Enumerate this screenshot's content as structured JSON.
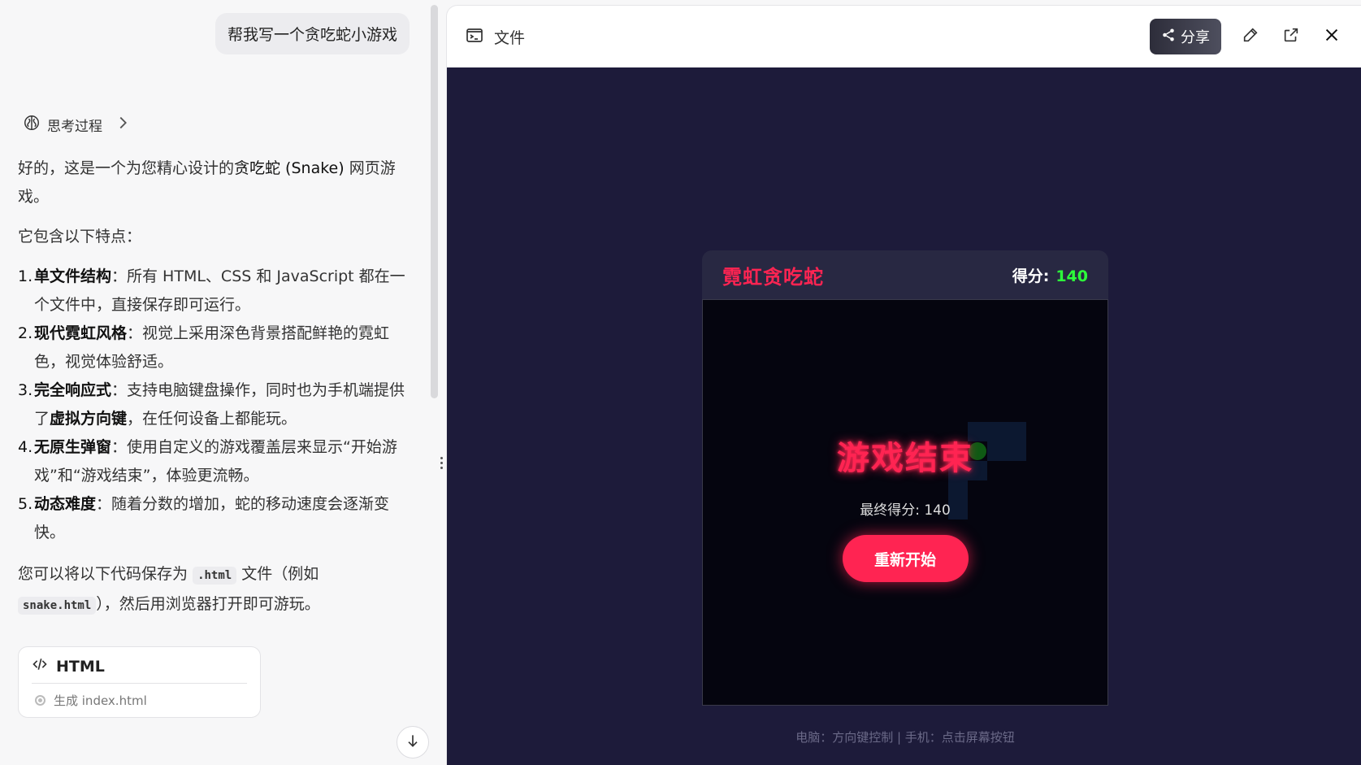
{
  "chat": {
    "user_message": "帮我写一个贪吃蛇小游戏",
    "thinking_label": "思考过程",
    "intro_part1": "好的，这是一个为您精心设计的",
    "intro_bold": "贪吃蛇 (Snake)",
    "intro_part2": " 网页游戏。",
    "features_heading": "它包含以下特点：",
    "features": [
      {
        "num": "1.",
        "title": "单文件结构",
        "text": "：所有 HTML、CSS 和 JavaScript 都在一个文件中，直接保存即可运行。"
      },
      {
        "num": "2.",
        "title": "现代霓虹风格",
        "text": "：视觉上采用深色背景搭配鲜艳的霓虹色，视觉体验舒适。"
      },
      {
        "num": "3.",
        "title": "完全响应式",
        "text": "：支持电脑键盘操作，同时也为手机端提供了",
        "bold2": "虚拟方向键",
        "text2": "，在任何设备上都能玩。"
      },
      {
        "num": "4.",
        "title": "无原生弹窗",
        "text": "：使用自定义的游戏覆盖层来显示“开始游戏”和“游戏结束”，体验更流畅。"
      },
      {
        "num": "5.",
        "title": "动态难度",
        "text": "：随着分数的增加，蛇的移动速度会逐渐变快。"
      }
    ],
    "save_text_1": "您可以将以下代码保存为",
    "save_chip_1": ".html",
    "save_text_2": "文件（例如",
    "save_chip_2": "snake.html",
    "save_text_3": "），然后用浏览器打开即可游玩。",
    "artifact": {
      "type_label": "HTML",
      "status_text": "生成 index.html"
    }
  },
  "preview": {
    "file_label": "文件",
    "share_label": "分享"
  },
  "game": {
    "title": "霓虹贪吃蛇",
    "score_label": "得分:",
    "score_value": "140",
    "gameover_title": "游戏结束",
    "final_score_text": "最终得分: 140",
    "restart_label": "重新开始",
    "controls_hint": "电脑：方向键控制 | 手机：点击屏幕按钮"
  },
  "colors": {
    "neon_red": "#ff2452",
    "neon_green": "#2dff3a",
    "stage_bg": "#1d1b3a",
    "board_bg": "#05050f"
  },
  "icons": [
    "brain-icon",
    "chevron-right-icon",
    "code-icon",
    "terminal-file-icon",
    "share-icon",
    "edit-icon",
    "external-link-icon",
    "close-icon",
    "arrow-down-icon"
  ]
}
